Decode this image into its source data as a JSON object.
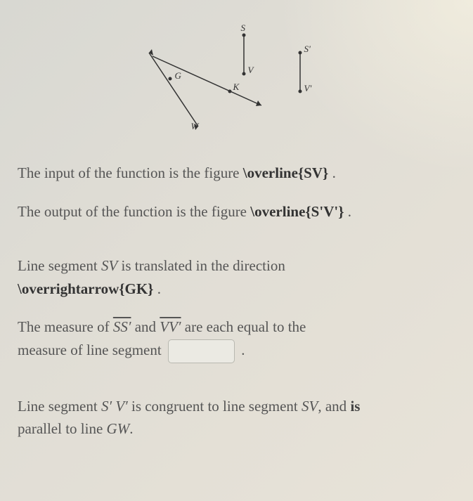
{
  "diagram": {
    "labels": {
      "S": "S",
      "G": "G",
      "V": "V",
      "K": "K",
      "W": "W",
      "Sp": "S'",
      "Vp": "V'"
    }
  },
  "p1": {
    "prefix": "The input of the function is the figure ",
    "latex": "\\overline{SV}",
    "suffix": " ."
  },
  "p2": {
    "prefix": "The output of the function is the figure ",
    "latex": "\\overline{S'V'}",
    "suffix": " ."
  },
  "p3": {
    "line1_prefix": "Line segment ",
    "line1_var": "SV",
    "line1_suffix": " is translated in the direction",
    "line2_latex": "\\overrightarrow{GK}",
    "line2_suffix": " ."
  },
  "p4": {
    "prefix": "The measure of ",
    "seg1": "SS′",
    "mid": " and ",
    "seg2": "VV′",
    "suffix": " are each equal to the",
    "line2_prefix": "measure of line segment ",
    "input_value": "",
    "line2_suffix": " ."
  },
  "p5": {
    "prefix": "Line segment ",
    "var1": "S′ V′",
    "mid1": " is congruent to line segment ",
    "var2": "SV",
    "mid2": ", and ",
    "bold_word": "is",
    "line2_prefix": "parallel to line ",
    "var3": "GW",
    "line2_suffix": "."
  }
}
